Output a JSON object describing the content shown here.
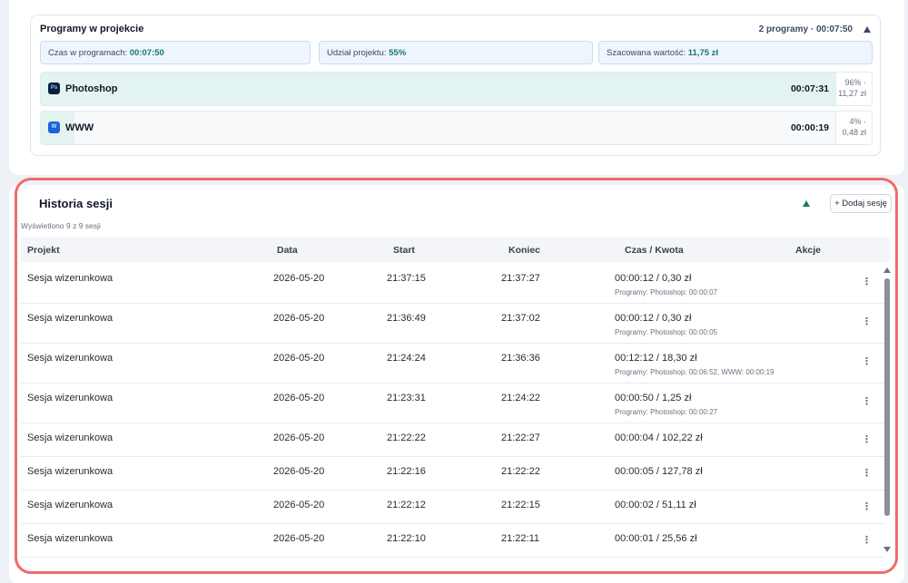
{
  "programs": {
    "title": "Programy w projekcie",
    "summary": "2 programy · 00:07:50",
    "stats": [
      {
        "label": "Czas w programach: ",
        "value": "00:07:50"
      },
      {
        "label": "Udział projektu: ",
        "value": "55%"
      },
      {
        "label": "Szacowana wartość: ",
        "value": "11,75 zł"
      }
    ],
    "items": [
      {
        "name": "Photoshop",
        "icon": "photoshop-icon",
        "icon_text": "Ps",
        "time": "00:07:31",
        "share_pct": "96% ·",
        "share_value": "11,27 zł",
        "fill_fraction": 0.96
      },
      {
        "name": "WWW",
        "icon": "www-icon",
        "icon_text": "W",
        "time": "00:00:19",
        "share_pct": "4% ·",
        "share_value": "0,48 zł",
        "fill_fraction": 0.04
      }
    ]
  },
  "history": {
    "title": "Historia sesji",
    "add_button": "+ Dodaj sesję",
    "shown_count": "Wyświetlono 9 z 9 sesji",
    "columns": [
      "Projekt",
      "Data",
      "Start",
      "Koniec",
      "Czas / Kwota",
      "Akcje"
    ],
    "rows": [
      {
        "project": "Sesja wizerunkowa",
        "date": "2026-05-20",
        "start": "21:37:15",
        "end": "21:37:27",
        "amount": "00:00:12 / 0,30 zł",
        "detail": "Programy: Photoshop: 00:00:07"
      },
      {
        "project": "Sesja wizerunkowa",
        "date": "2026-05-20",
        "start": "21:36:49",
        "end": "21:37:02",
        "amount": "00:00:12 / 0,30 zł",
        "detail": "Programy: Photoshop: 00:00:05"
      },
      {
        "project": "Sesja wizerunkowa",
        "date": "2026-05-20",
        "start": "21:24:24",
        "end": "21:36:36",
        "amount": "00:12:12 / 18,30 zł",
        "detail": "Programy: Photoshop: 00:06:52, WWW: 00:00:19"
      },
      {
        "project": "Sesja wizerunkowa",
        "date": "2026-05-20",
        "start": "21:23:31",
        "end": "21:24:22",
        "amount": "00:00:50 / 1,25 zł",
        "detail": "Programy: Photoshop: 00:00:27"
      },
      {
        "project": "Sesja wizerunkowa",
        "date": "2026-05-20",
        "start": "21:22:22",
        "end": "21:22:27",
        "amount": "00:00:04 / 102,22 zł",
        "detail": ""
      },
      {
        "project": "Sesja wizerunkowa",
        "date": "2026-05-20",
        "start": "21:22:16",
        "end": "21:22:22",
        "amount": "00:00:05 / 127,78 zł",
        "detail": ""
      },
      {
        "project": "Sesja wizerunkowa",
        "date": "2026-05-20",
        "start": "21:22:12",
        "end": "21:22:15",
        "amount": "00:00:02 / 51,11 zł",
        "detail": ""
      },
      {
        "project": "Sesja wizerunkowa",
        "date": "2026-05-20",
        "start": "21:22:10",
        "end": "21:22:11",
        "amount": "00:00:01 / 25,56 zł",
        "detail": ""
      }
    ],
    "row_action_glyph": "⋮"
  },
  "colors": {
    "accent": "#1a7a6c",
    "highlight": "#ef6b6b",
    "stat_bg": "#eef5fd"
  }
}
